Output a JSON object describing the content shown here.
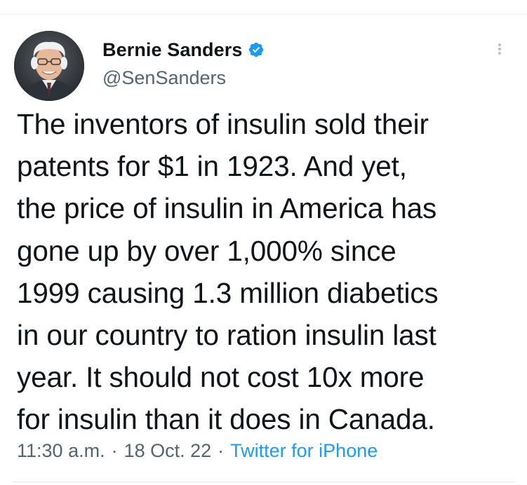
{
  "tweet": {
    "author": {
      "display_name": "Bernie Sanders",
      "handle": "@SenSanders",
      "verified": true,
      "avatar_icon": "avatar-photo"
    },
    "text_lines": [
      "The inventors of insulin sold their",
      "patents for $1 in 1923. And yet,",
      "the price of insulin in America has",
      "gone up by over 1,000% since",
      "1999 causing 1.3 million diabetics",
      "in our country to ration insulin last",
      "year. It should not cost 10x more",
      "for insulin than it does in Canada."
    ],
    "meta": {
      "time": "11:30 a.m.",
      "separator": "·",
      "date": "18 Oct. 22",
      "source": "Twitter for iPhone"
    }
  },
  "icons": {
    "verified": "verified-badge-icon",
    "more": "more-options-icon"
  },
  "colors": {
    "text_primary": "#0f1419",
    "text_secondary": "#536471",
    "link": "#1d9bf0",
    "verified_badge": "#1d9bf0",
    "divider": "#eff3f4"
  }
}
